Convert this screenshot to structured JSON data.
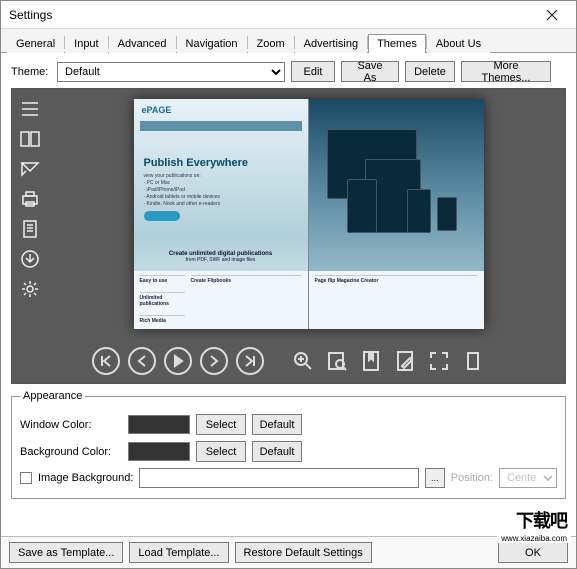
{
  "window": {
    "title": "Settings"
  },
  "tabs": {
    "general": "General",
    "input": "Input",
    "advanced": "Advanced",
    "navigation": "Navigation",
    "zoom": "Zoom",
    "advertising": "Advertising",
    "themes": "Themes",
    "about": "About Us"
  },
  "theme_row": {
    "label": "Theme:",
    "selected": "Default",
    "edit": "Edit",
    "save_as": "Save As",
    "delete": "Delete",
    "more": "More Themes..."
  },
  "preview": {
    "logo": "ePAGE",
    "headline": "Publish Everywhere",
    "sub1": "view your publications on:",
    "sub2": "· PC or Mac",
    "sub3": "· iPad/iPhone/iPod",
    "sub4": "· Android tablets or mobile devices",
    "sub5": "· Kindle, Nook and other e-readers",
    "caption": "Create unlimited digital publications",
    "caption2": "from PDF, SWF and image files",
    "col1": "Easy to use",
    "col2": "Create Flipbooks",
    "col3": "Page flip Magazine Creator",
    "col1b": "Unlimited publications",
    "col1c": "Rich Media"
  },
  "appearance": {
    "legend": "Appearance",
    "window_color": "Window Color:",
    "background_color": "Background Color:",
    "select": "Select",
    "default": "Default",
    "image_bg": "Image Background:",
    "position": "Position:",
    "position_value": "Center"
  },
  "bottom": {
    "save_template": "Save as Template...",
    "load_template": "Load Template...",
    "restore": "Restore Default Settings",
    "ok": "OK"
  },
  "watermark": "www.xiazaiba.com"
}
